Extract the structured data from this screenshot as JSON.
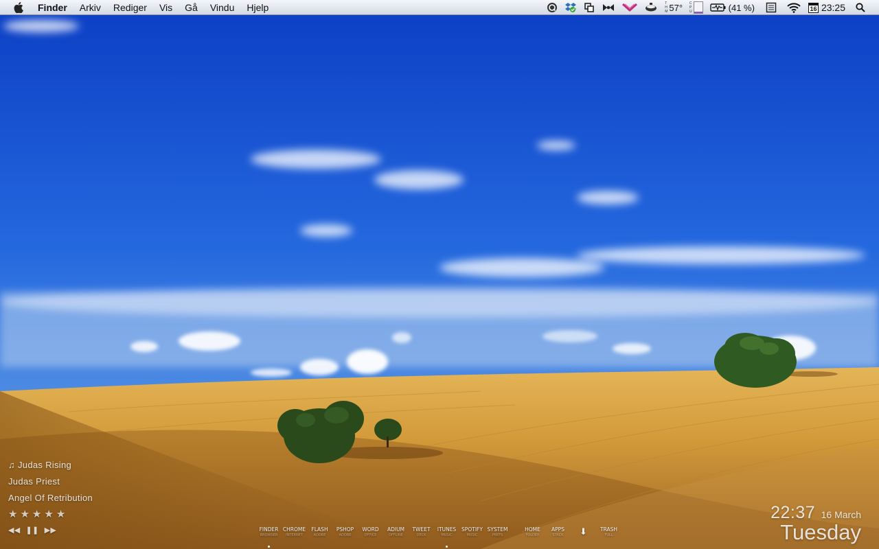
{
  "menubar": {
    "apple_icon": "apple-logo-icon",
    "app_name": "Finder",
    "menus": [
      "Arkiv",
      "Rediger",
      "Vis",
      "Gå",
      "Vindu",
      "Hjelp"
    ],
    "tray": {
      "temperature": "57°",
      "battery_percent": "(41 %)",
      "calendar_day": "16",
      "time": "23:25",
      "icons": [
        "quicksilver-icon",
        "dropbox-icon",
        "spaces-icon",
        "growl-icon",
        "mail-check-icon",
        "caffeine-icon",
        "temperature-icon",
        "cpu-meter-icon",
        "battery-icon",
        "clipboard-icon",
        "wifi-icon",
        "calendar-icon",
        "spotlight-icon"
      ]
    }
  },
  "now_playing": {
    "track": "Judas Rising",
    "artist": "Judas Priest",
    "album": "Angel Of Retribution",
    "rating_stars": 0,
    "rating_max": 5
  },
  "clock": {
    "time": "22:37",
    "date": "16 March",
    "day": "Tuesday"
  },
  "dock": {
    "items": [
      {
        "label": "FINDER",
        "sub": "BROWSER",
        "running": true
      },
      {
        "label": "CHROME",
        "sub": "INTERNET",
        "running": false
      },
      {
        "label": "FLASH",
        "sub": "ADOBE",
        "running": false
      },
      {
        "label": "PSHOP",
        "sub": "ADOBE",
        "running": false
      },
      {
        "label": "WORD",
        "sub": "OFFICE",
        "running": false
      },
      {
        "label": "ADIUM",
        "sub": "OFFLINE",
        "running": false
      },
      {
        "label": "TWEET",
        "sub": "DECK",
        "running": false
      },
      {
        "label": "ITUNES",
        "sub": "MUSIC",
        "running": true
      },
      {
        "label": "SPOTIFY",
        "sub": "MUSIC",
        "running": false
      },
      {
        "label": "SYSTEM",
        "sub": "PREFS",
        "running": false
      }
    ],
    "right_items": [
      {
        "label": "HOME",
        "sub": "FOLDER"
      },
      {
        "label": "APPS",
        "sub": "STACK"
      },
      {
        "label": "",
        "sub": "",
        "icon": "downloads-arrow-icon"
      },
      {
        "label": "TRASH",
        "sub": "FULL"
      }
    ]
  },
  "colors": {
    "sky_top": "#1046c8",
    "sky_bottom": "#5a9be8",
    "field_light": "#dba545",
    "field_dark": "#a56a1a",
    "tree": "#2f5a22"
  }
}
